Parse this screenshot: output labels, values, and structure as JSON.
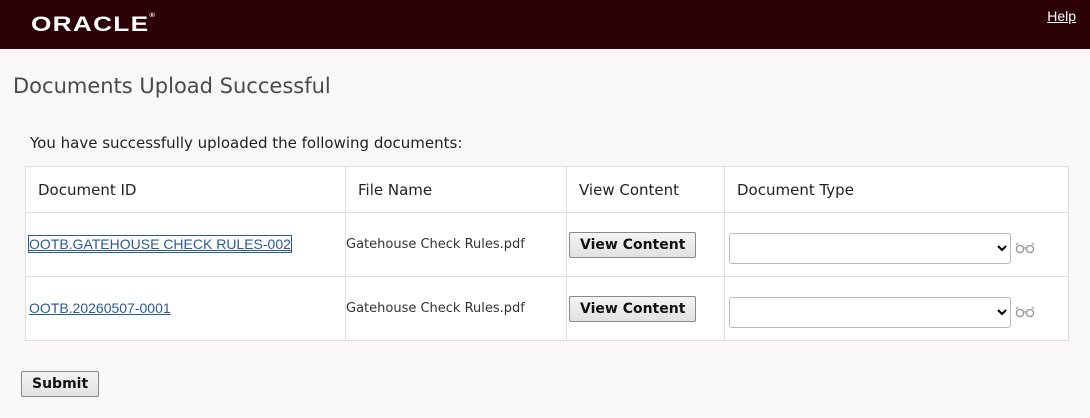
{
  "header": {
    "logo_text": "ORACLE",
    "logo_mark": "®",
    "help_label": "Help"
  },
  "page": {
    "title": "Documents Upload Successful",
    "intro": "You have successfully uploaded the following documents:"
  },
  "table": {
    "columns": [
      "Document ID",
      "File Name",
      "View Content",
      "Document Type"
    ],
    "rows": [
      {
        "document_id": "OOTB.GATEHOUSE CHECK RULES-002",
        "file_name": "Gatehouse Check Rules.pdf",
        "view_label": "View Content",
        "document_type": ""
      },
      {
        "document_id": "OOTB.20260507-0001",
        "file_name": "Gatehouse Check Rules.pdf",
        "view_label": "View Content",
        "document_type": ""
      }
    ]
  },
  "actions": {
    "submit_label": "Submit"
  },
  "colors": {
    "header_bg": "#2b0006",
    "link": "#2a5a9a"
  },
  "icons": {
    "logo": "oracle-logo",
    "lookup": "glasses-icon"
  }
}
